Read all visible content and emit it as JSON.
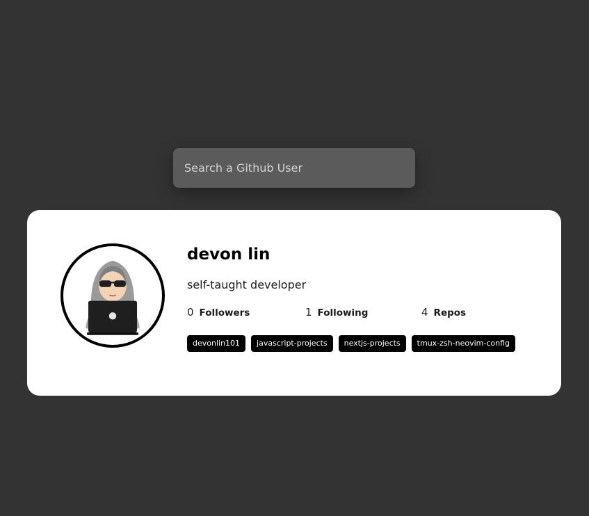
{
  "search": {
    "placeholder": "Search a Github User"
  },
  "profile": {
    "name": "devon lin",
    "bio": "self-taught developer",
    "stats": [
      {
        "value": "0",
        "label": "Followers"
      },
      {
        "value": "1",
        "label": "Following"
      },
      {
        "value": "4",
        "label": "Repos"
      }
    ],
    "repos": [
      "devonlin101",
      "javascript-projects",
      "nextjs-projects",
      "tmux-zsh-neovim-config"
    ]
  },
  "colors": {
    "background": "#333333",
    "card": "#ffffff",
    "search_bg": "#5b5b5b",
    "repo_tag_bg": "#000000"
  },
  "icons": {
    "avatar": "hooded-hacker-laptop-icon"
  }
}
